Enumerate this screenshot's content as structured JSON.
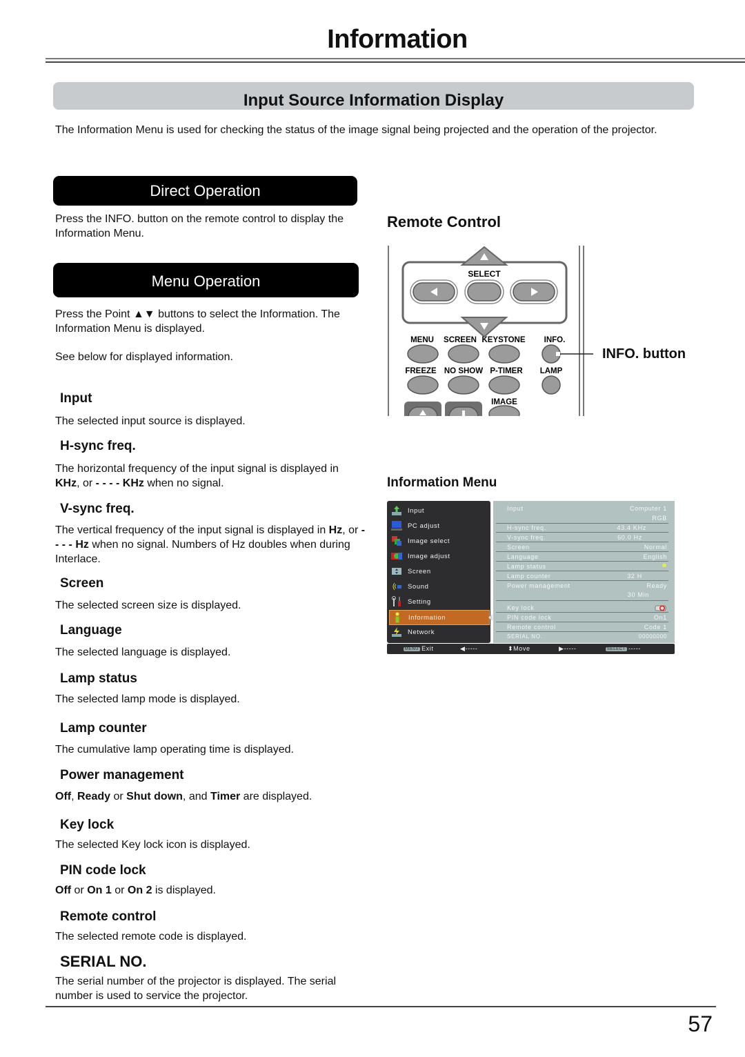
{
  "page": {
    "title": "Information",
    "section_title": "Input Source Information Display",
    "intro": "The Information Menu is used for checking the status of the image signal being projected and the operation of the projector.",
    "page_number": "57"
  },
  "direct_operation": {
    "label": "Direct Operation",
    "text": "Press the INFO. button on the remote control to display the Information Menu."
  },
  "menu_operation": {
    "label": "Menu Operation",
    "text_1": "Press the Point ▲▼ buttons to select the Information. The Information Menu is displayed.",
    "text_2": "See below for displayed information."
  },
  "items": [
    {
      "title": "Input",
      "desc": "The selected input source is displayed."
    },
    {
      "title": "H-sync freq.",
      "desc_parts": [
        "The horizontal frequency of the input signal is displayed in ",
        "KHz",
        ", or ",
        "- - - - KHz",
        " when no signal."
      ]
    },
    {
      "title": "V-sync freq.",
      "desc_parts": [
        "The vertical frequency of the input signal is displayed in ",
        "Hz",
        ", or ",
        "- - - - Hz",
        " when no signal. Numbers of Hz doubles when during Interlace."
      ]
    },
    {
      "title": "Screen",
      "desc": "The selected screen size is displayed."
    },
    {
      "title": "Language",
      "desc": "The selected language is displayed."
    },
    {
      "title": "Lamp status",
      "desc": "The selected lamp mode is displayed."
    },
    {
      "title": "Lamp counter",
      "desc": "The cumulative lamp operating time is displayed."
    },
    {
      "title": "Power management",
      "desc_parts": [
        "Off",
        ", ",
        "Ready",
        " or ",
        "Shut down",
        ", and ",
        "Timer",
        " are displayed."
      ]
    },
    {
      "title": "Key lock",
      "desc": "The selected Key lock icon is displayed."
    },
    {
      "title": "PIN code lock",
      "desc_parts": [
        "Off",
        " or ",
        "On 1",
        " or ",
        "On 2",
        " is displayed."
      ]
    },
    {
      "title": "Remote control",
      "desc": "The selected remote code  is displayed."
    },
    {
      "title": "SERIAL NO.",
      "desc": "The serial number of the projector is displayed. The serial number is used to service the projector."
    }
  ],
  "remote": {
    "heading": "Remote Control",
    "select_label": "SELECT",
    "row1": [
      "MENU",
      "SCREEN",
      "KEYSTONE",
      "INFO."
    ],
    "row2": [
      "FREEZE",
      "NO SHOW",
      "P-TIMER",
      "LAMP"
    ],
    "row3": [
      "IMAGE"
    ],
    "callout": "INFO. button"
  },
  "info_menu": {
    "heading": "Information Menu",
    "menu_items": [
      {
        "label": "Input",
        "icon": "input-icon"
      },
      {
        "label": "PC adjust",
        "icon": "pc-adjust-icon"
      },
      {
        "label": "Image select",
        "icon": "image-select-icon"
      },
      {
        "label": "Image adjust",
        "icon": "image-adjust-icon"
      },
      {
        "label": "Screen",
        "icon": "screen-icon"
      },
      {
        "label": "Sound",
        "icon": "sound-icon"
      },
      {
        "label": "Setting",
        "icon": "setting-icon"
      },
      {
        "label": "Information",
        "icon": "information-icon",
        "selected": true
      },
      {
        "label": "Network",
        "icon": "network-icon"
      }
    ],
    "rows": [
      {
        "key": "Input",
        "value": "Computer 1",
        "value2": "RGB"
      },
      {
        "key": "H-sync freq.",
        "value": "43.4  KHz"
      },
      {
        "key": "V-sync freq.",
        "value": "60.0  Hz"
      },
      {
        "key": "Screen",
        "value": "Normal"
      },
      {
        "key": "Language",
        "value": "English"
      },
      {
        "key": "Lamp status",
        "value": "lamp-status-icon"
      },
      {
        "key": "Lamp counter",
        "value": "32  H"
      },
      {
        "key": "Power management",
        "value": "Ready",
        "value2": "30  Min"
      },
      {
        "key": "Key lock",
        "value": "key-lock-icon"
      },
      {
        "key": "PIN code lock",
        "value": "On1"
      },
      {
        "key": "Remote control",
        "value": "Code 1"
      },
      {
        "key": "SERIAL NO.",
        "value": "00000000"
      }
    ],
    "footer": {
      "menu_key": "MENU",
      "exit": "Exit",
      "left": "-----",
      "move": "Move",
      "right": "-----",
      "select_key": "SELECT",
      "select": "-----"
    }
  }
}
